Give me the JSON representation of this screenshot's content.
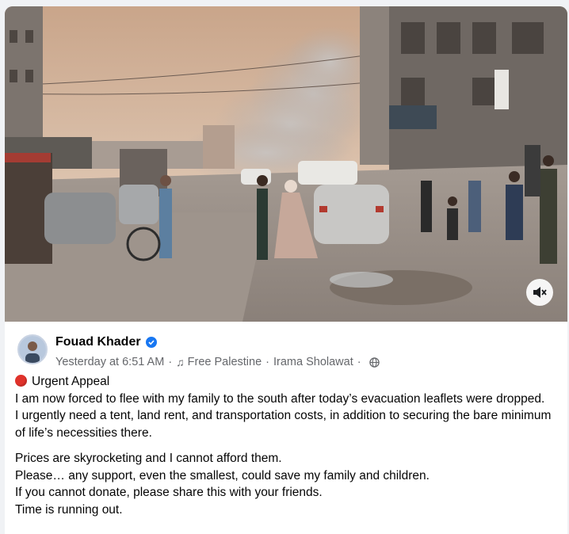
{
  "post": {
    "author": "Fouad Khader",
    "timestamp": "Yesterday at 6:51 AM",
    "audio_track": "Free Palestine",
    "audio_artist": "Irama Sholawat",
    "audience": "globe-icon",
    "appeal_title": "Urgent Appeal",
    "lines_block1": [
      "I am now forced to flee with my family to the south after today’s evacuation leaflets were dropped.",
      "I urgently need a tent, land rent, and transportation costs, in addition to securing the bare minimum of life’s necessities there."
    ],
    "lines_block2": [
      "Prices are skyrocketing and I cannot afford them.",
      "Please… any support, even the smallest, could save my family and children.",
      "If you cannot donate, please share this with your friends.",
      "Time is running out."
    ]
  },
  "media": {
    "type": "video",
    "mute_icon": "speaker-muted-icon"
  },
  "colors": {
    "verified": "#1877f2",
    "secondary_text": "#65676b",
    "urgent_dot": "#e0322b"
  }
}
